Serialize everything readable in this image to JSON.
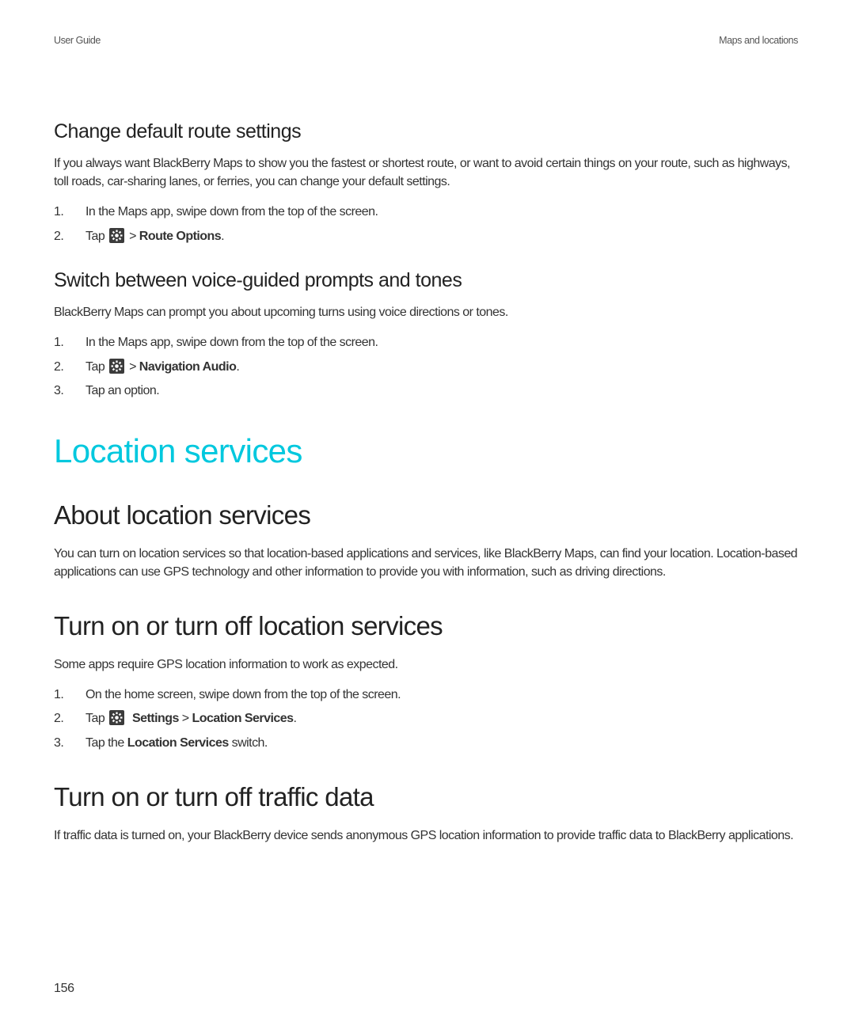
{
  "header": {
    "left": "User Guide",
    "right": "Maps and locations"
  },
  "pageNumber": "156",
  "sections": {
    "route": {
      "title": "Change default route settings",
      "intro": "If you always want BlackBerry Maps to show you the fastest or shortest route, or want to avoid certain things on your route, such as highways, toll roads, car-sharing lanes, or ferries, you can change your default settings.",
      "steps": {
        "s1_num": "1.",
        "s1_text": "In the Maps app, swipe down from the top of the screen.",
        "s2_num": "2.",
        "s2_pre": "Tap ",
        "s2_gt": " > ",
        "s2_bold": "Route Options",
        "s2_suffix": "."
      }
    },
    "voice": {
      "title": "Switch between voice-guided prompts and tones",
      "intro": "BlackBerry Maps can prompt you about upcoming turns using voice directions or tones.",
      "steps": {
        "s1_num": "1.",
        "s1_text": "In the Maps app, swipe down from the top of the screen.",
        "s2_num": "2.",
        "s2_pre": "Tap ",
        "s2_gt": " > ",
        "s2_bold": "Navigation Audio",
        "s2_suffix": ".",
        "s3_num": "3.",
        "s3_text": "Tap an option."
      }
    },
    "locServices": {
      "heading": "Location services",
      "about": {
        "title": "About location services",
        "intro": "You can turn on location services so that location-based applications and services, like BlackBerry Maps, can find your location. Location-based applications can use GPS technology and other information to provide you with information, such as driving directions."
      },
      "toggleLoc": {
        "title": "Turn on or turn off location services",
        "intro": "Some apps require GPS location information to work as expected.",
        "steps": {
          "s1_num": "1.",
          "s1_text": "On the home screen, swipe down from the top of the screen.",
          "s2_num": "2.",
          "s2_pre": "Tap ",
          "s2_bold1": "Settings",
          "s2_mid": " > ",
          "s2_bold2": "Location Services",
          "s2_suffix": ".",
          "s3_num": "3.",
          "s3_pre": "Tap the ",
          "s3_bold": "Location Services",
          "s3_suffix": " switch."
        }
      },
      "traffic": {
        "title": "Turn on or turn off traffic data",
        "intro": "If traffic data is turned on, your BlackBerry device sends anonymous GPS location information to provide traffic data to BlackBerry applications."
      }
    }
  }
}
